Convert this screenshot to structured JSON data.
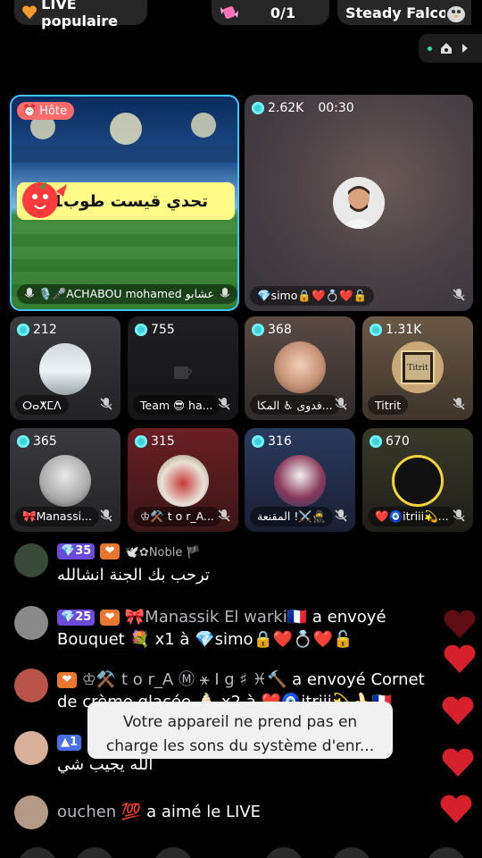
{
  "top": {
    "live_label": "LIVE populaire",
    "game_count": "0/1",
    "user_name": "Steady Falcon"
  },
  "host_tile": {
    "badge": "Hôte",
    "challenge_text": "تحدي قيست طوب1",
    "name": "🎙️🎤ACHABOU mohamed عشابو"
  },
  "big_tile": {
    "viewers": "2.62K",
    "timer": "00:30",
    "name": "💎simo🔒❤️💍❤️🔓"
  },
  "guest_tiles": [
    {
      "viewers": "212",
      "name": "ⵔⴰⵅⵎⴷ"
    },
    {
      "viewers": "755",
      "name": "Team 😎 ha..."
    },
    {
      "viewers": "368",
      "name": "فدوى ♿ المكا..."
    },
    {
      "viewers": "1.31K",
      "name": "Titrit"
    },
    {
      "viewers": "365",
      "name": "🎀Manassi..."
    },
    {
      "viewers": "315",
      "name": "♔⚒️ t o r_A..."
    },
    {
      "viewers": "316",
      "name": "المقنعة !⚔️🥷"
    },
    {
      "viewers": "670",
      "name": "❤️🧿itriii💫..."
    }
  ],
  "chat": [
    {
      "level": "35",
      "name": "🕊️✿Noble 🏴",
      "text": "ترحب بك الجنة انشالله"
    },
    {
      "level": "25",
      "name": "🎀Manassik El warki🇫🇷",
      "action": "a envoyé",
      "text": "Bouquet 💐 x1 à 💎simo🔒❤️💍❤️🔓"
    },
    {
      "level": "",
      "name": "♔⚒️ t o r_A Ⓜ ⚹ I g ♯ ♓🔨",
      "action": "a envoyé Cornet",
      "text": "de crème glacée 🍦 x2 à ❤️🧿itriii💫🍌🇫🇷"
    },
    {
      "level": "1",
      "name": "",
      "text": "الله يجيب شي"
    },
    {
      "level": "",
      "name": "ouchen 💯",
      "action": "a aimé le LIVE"
    }
  ],
  "toast": "Votre appareil ne prend pas en charge les sons du système d'enr...",
  "colors": {
    "host_border": "#40c6ff",
    "heart": "#d6202c",
    "gem": "#3fd0d8"
  }
}
